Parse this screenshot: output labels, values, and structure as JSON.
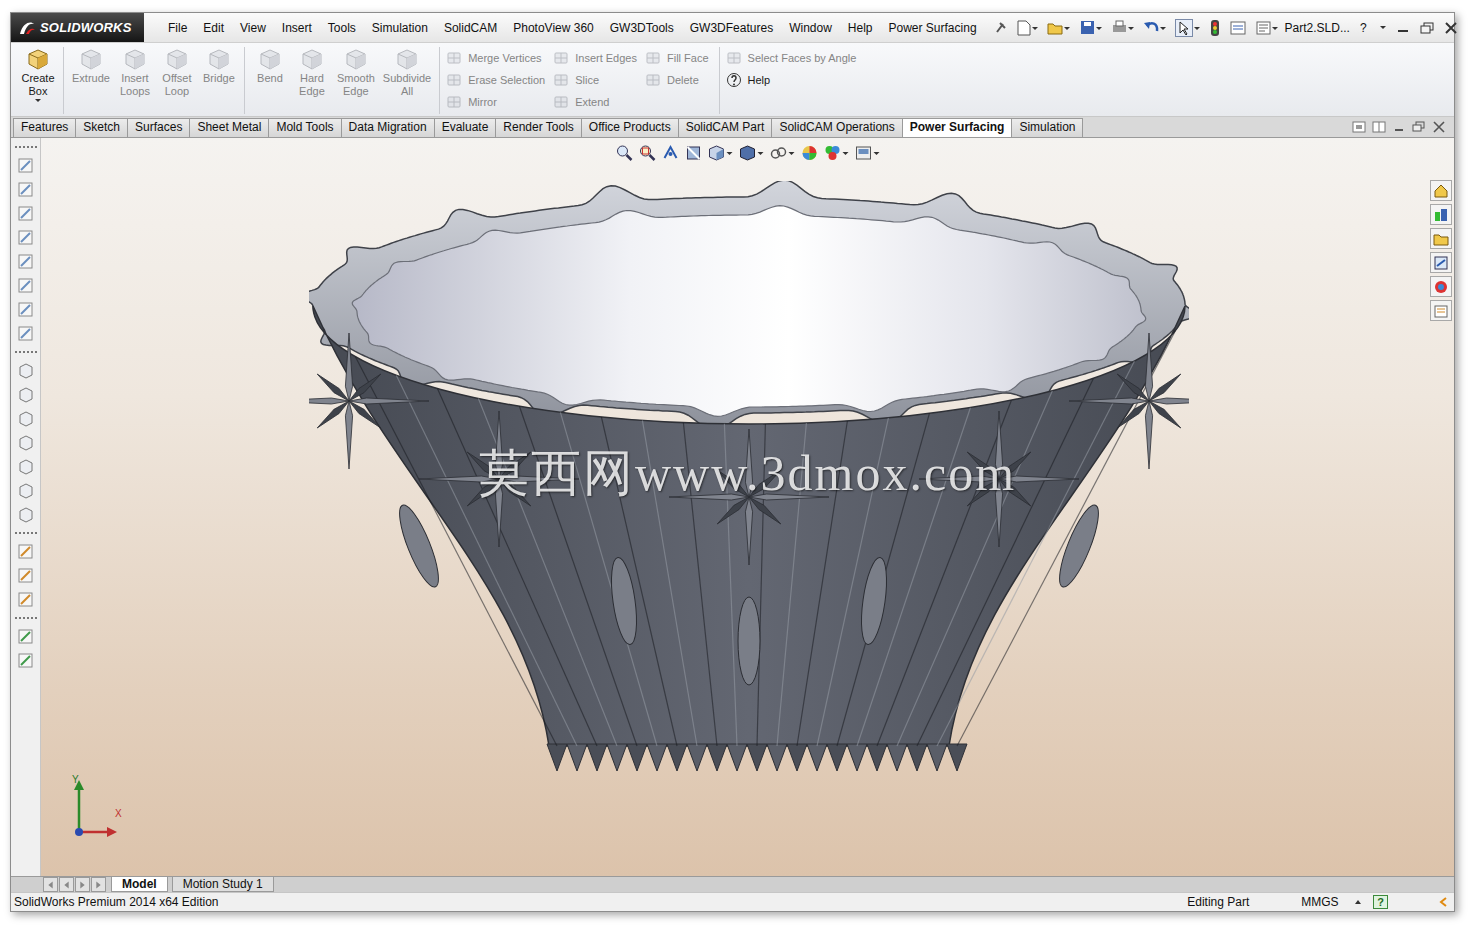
{
  "window": {
    "app_logo": "SOLIDWORKS",
    "title": "Part2.SLD...",
    "help": "?"
  },
  "menu": [
    "File",
    "Edit",
    "View",
    "Insert",
    "Tools",
    "Simulation",
    "SolidCAM",
    "PhotoView 360",
    "GW3DTools",
    "GW3DFeatures",
    "Window",
    "Help",
    "Power Surfacing"
  ],
  "ribbon": {
    "groups": [
      [
        {
          "label": "Create Box",
          "disabled": false
        }
      ],
      [
        {
          "label": "Extrude",
          "disabled": true
        },
        {
          "label": "Insert Loops",
          "disabled": true
        },
        {
          "label": "Offset Loop",
          "disabled": true
        },
        {
          "label": "Bridge",
          "disabled": true
        }
      ],
      [
        {
          "label": "Bend",
          "disabled": true
        },
        {
          "label": "Hard Edge",
          "disabled": true
        },
        {
          "label": "Smooth Edge",
          "disabled": true
        },
        {
          "label": "Subdivide All",
          "disabled": true
        }
      ]
    ],
    "columns": [
      [
        {
          "label": "Merge Vertices",
          "disabled": true
        },
        {
          "label": "Erase Selection",
          "disabled": true
        },
        {
          "label": "Mirror",
          "disabled": true
        }
      ],
      [
        {
          "label": "Insert Edges",
          "disabled": true
        },
        {
          "label": "Slice",
          "disabled": true
        },
        {
          "label": "Extend",
          "disabled": true
        }
      ],
      [
        {
          "label": "Fill Face",
          "disabled": true
        },
        {
          "label": "Delete",
          "disabled": true
        }
      ],
      [
        {
          "label": "Select Faces by Angle",
          "disabled": true
        },
        {
          "label": "Help",
          "disabled": false
        }
      ]
    ]
  },
  "tabs": [
    {
      "label": "Features",
      "selected": false
    },
    {
      "label": "Sketch",
      "selected": false
    },
    {
      "label": "Surfaces",
      "selected": false
    },
    {
      "label": "Sheet Metal",
      "selected": false
    },
    {
      "label": "Mold Tools",
      "selected": false
    },
    {
      "label": "Data Migration",
      "selected": false
    },
    {
      "label": "Evaluate",
      "selected": false
    },
    {
      "label": "Render Tools",
      "selected": false
    },
    {
      "label": "Office Products",
      "selected": false
    },
    {
      "label": "SolidCAM Part",
      "selected": false
    },
    {
      "label": "SolidCAM Operations",
      "selected": false
    },
    {
      "label": "Power Surfacing",
      "selected": true
    },
    {
      "label": "Simulation",
      "selected": false
    }
  ],
  "viewport": {
    "watermark": "莫西网www.3dmox.com",
    "triad": [
      "Y",
      "X"
    ]
  },
  "bottom_tabs": [
    {
      "label": "Model",
      "selected": true
    },
    {
      "label": "Motion Study 1",
      "selected": false
    }
  ],
  "status_bar": {
    "edition": "SolidWorks Premium 2014 x64 Edition",
    "mode": "Editing Part",
    "units": "MMGS",
    "help": "?"
  }
}
